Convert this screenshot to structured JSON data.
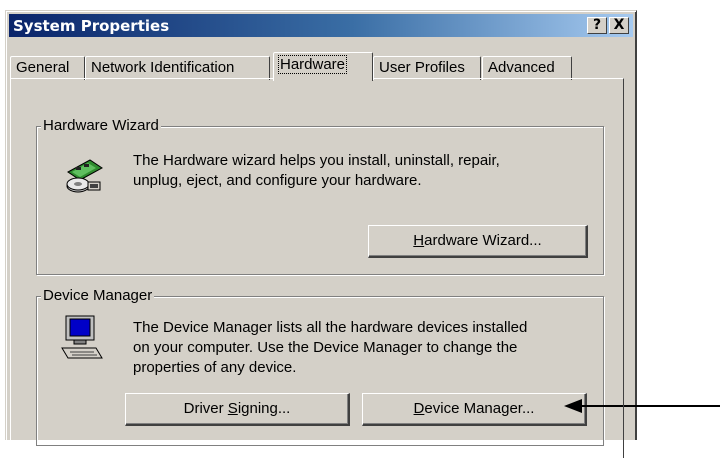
{
  "window": {
    "title": "System Properties",
    "help_button": "?",
    "close_button": "X"
  },
  "tabs": [
    {
      "label": "General",
      "active": false
    },
    {
      "label": "Network Identification",
      "active": false
    },
    {
      "label": "Hardware",
      "active": true
    },
    {
      "label": "User Profiles",
      "active": false
    },
    {
      "label": "Advanced",
      "active": false
    }
  ],
  "hardware_wizard": {
    "group_label": "Hardware Wizard",
    "description_lines": [
      "The Hardware wizard helps you install, uninstall, repair,",
      "unplug, eject, and configure your hardware."
    ],
    "button": {
      "mnemonic": "H",
      "rest": "ardware Wizard..."
    },
    "icon": "hardware-wizard-icon"
  },
  "device_manager": {
    "group_label": "Device Manager",
    "description_lines": [
      "The Device Manager lists all the hardware devices installed",
      "on your computer. Use the Device Manager to change the",
      "properties of any device."
    ],
    "driver_signing_button": {
      "pre": "Driver ",
      "mnemonic": "S",
      "rest": "igning..."
    },
    "device_manager_button": {
      "mnemonic": "D",
      "rest": "evice Manager..."
    },
    "icon": "computer-icon"
  },
  "annotation": {
    "type": "arrow",
    "points_to": "device-manager-button",
    "color": "#000000"
  }
}
